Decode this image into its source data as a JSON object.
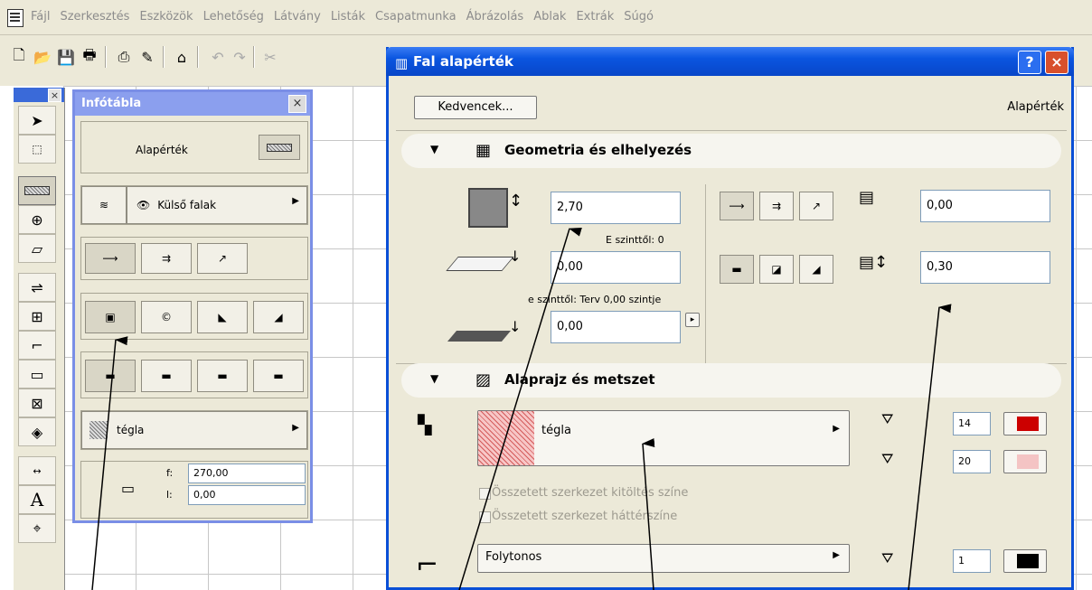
{
  "menu": {
    "items": [
      "Fájl",
      "Szerkesztés",
      "Eszközök",
      "Lehetőség",
      "Látvány",
      "Listák",
      "Csapatmunka",
      "Ábrázolás",
      "Ablak",
      "Extrák",
      "Súgó"
    ]
  },
  "info_panel": {
    "title": "Infótábla",
    "default_label": "Alapérték",
    "layer_label": "Külső falak",
    "material_label": "tégla",
    "f_label": "f:",
    "f_value": "270,00",
    "l_label": "l:",
    "l_value": "0,00"
  },
  "dialog": {
    "title": "Fal alapérték",
    "favorites_button": "Kedvencek...",
    "default_label": "Alapérték",
    "help_glyph": "?",
    "close_glyph": "×",
    "section1": {
      "title": "Geometria és elhelyezés",
      "height_value": "2,70",
      "base_level_label": "E szinttől: 0",
      "base_offset_value": "0,00",
      "story_label": "e szinttől: Terv 0,00 szintje",
      "story_value": "0,00",
      "offset_value": "0,00",
      "thickness_value": "0,30"
    },
    "section2": {
      "title": "Alaprajz és metszet",
      "fill_label": "tégla",
      "pen1_value": "14",
      "pen2_value": "20",
      "composite_fill_color": "Összetett szerkezet kitöltés színe",
      "composite_bg_color": "Összetett szerkezet háttérszíne",
      "line_type": "Folytonos",
      "pen3_value": "1"
    }
  },
  "colors": {
    "dialog_title_blue": "#0a55e0",
    "info_title": "#8b9fee",
    "pen_red": "#cc0000",
    "pen_pink": "#f4c4c4"
  }
}
